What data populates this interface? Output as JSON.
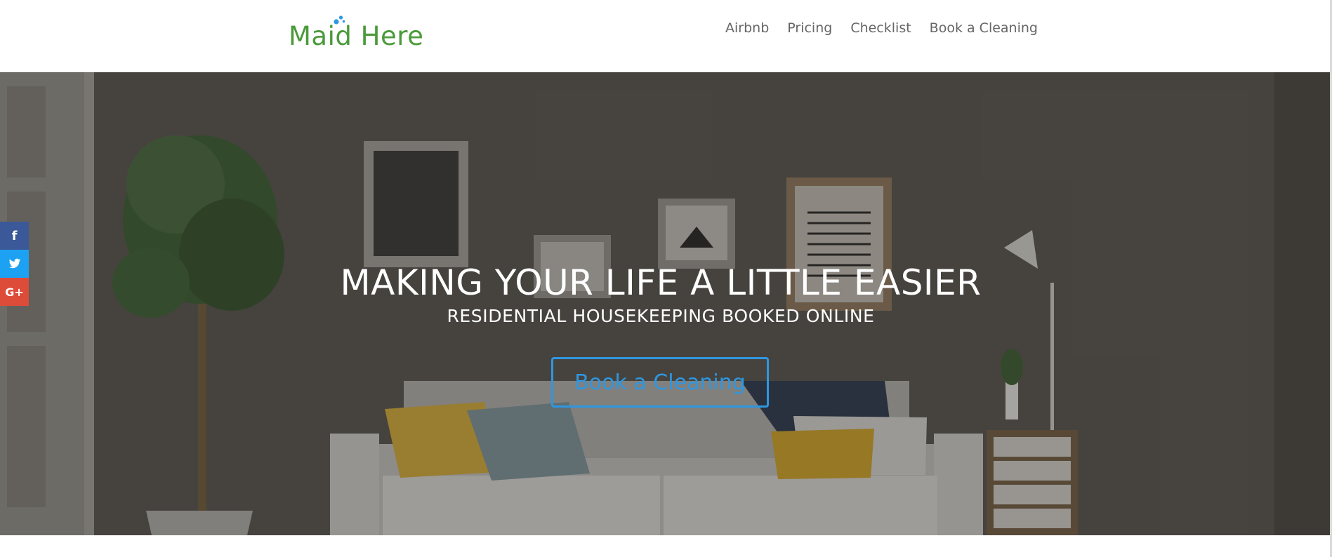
{
  "header": {
    "logo_text": "Maid Here",
    "nav": [
      {
        "label": "Airbnb"
      },
      {
        "label": "Pricing"
      },
      {
        "label": "Checklist"
      },
      {
        "label": "Book a Cleaning"
      }
    ]
  },
  "hero": {
    "title": "MAKING YOUR LIFE A LITTLE EASIER",
    "subtitle": "RESIDENTIAL HOUSEKEEPING BOOKED ONLINE",
    "button_label": "Book a Cleaning"
  },
  "social": {
    "facebook_label": "f",
    "twitter_icon": "twitter-bird-icon",
    "googleplus_label": "G+"
  },
  "colors": {
    "logo_green": "#4a9a3a",
    "logo_bubbles": "#2e97e2",
    "nav_text": "#666666",
    "button_blue": "#2e97e2",
    "facebook": "#3b5998",
    "twitter": "#1da1f2",
    "googleplus": "#dd4b39"
  }
}
